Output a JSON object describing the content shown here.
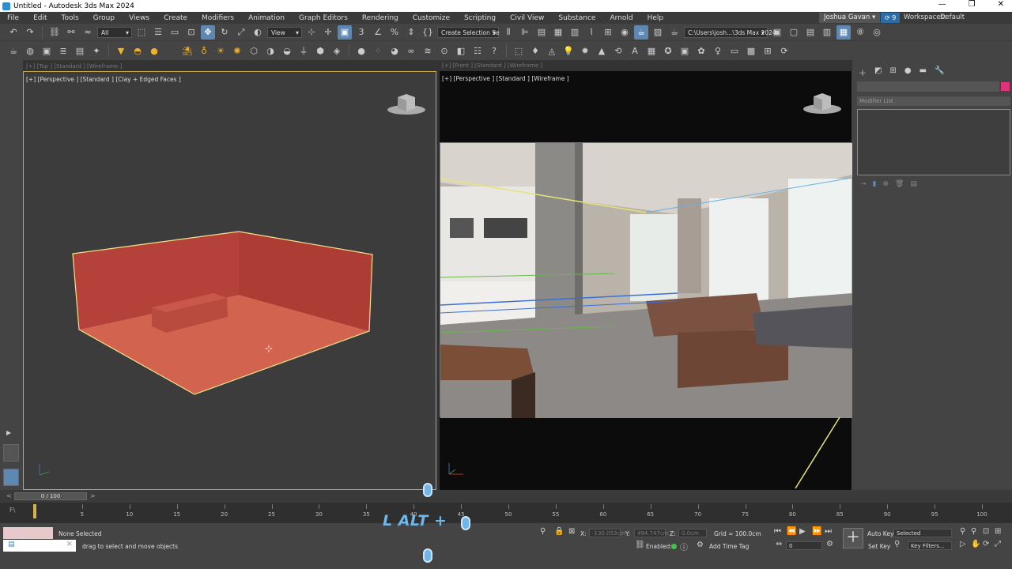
{
  "titlebar": {
    "title": "Untitled - Autodesk 3ds Max 2024",
    "min": "—",
    "restore": "❐",
    "close": "✕"
  },
  "menu": {
    "items": [
      "File",
      "Edit",
      "Tools",
      "Group",
      "Views",
      "Create",
      "Modifiers",
      "Animation",
      "Graph Editors",
      "Rendering",
      "Customize",
      "Scripting",
      "Civil View",
      "Substance",
      "Arnold",
      "Help"
    ],
    "user": "Joshua Gavan ▾",
    "sync_badge": "9",
    "workspaces_label": "Workspaces:",
    "workspaces_value": "Default"
  },
  "toolbar1": {
    "selection_filter": "All",
    "reference_coord": "View",
    "named_selection": "Create Selection Se",
    "project_path": "C:\\Users\\josh...\\3ds Max 2024"
  },
  "viewports": {
    "left": {
      "label": "[+] [Perspective ] [Standard ] [Clay + Edged Faces ]",
      "ghost": "[+] [Top ] [Standard ] [Wireframe ]"
    },
    "right": {
      "label": "[+] [Perspective ] [Standard ] [Wireframe ]",
      "ghost": "[+] [Front ] [Standard ] [Wireframe ]"
    }
  },
  "command_panel": {
    "modifier_list": "Modifier List",
    "accent_color": "#e0347a"
  },
  "timeslider": {
    "position": "0 / 100",
    "left_arrow": "<",
    "right_arrow": ">"
  },
  "trackbar": {
    "label": "F\\",
    "ticks": [
      "5",
      "10",
      "15",
      "20",
      "25",
      "30",
      "35",
      "40",
      "45",
      "50",
      "55",
      "60",
      "65",
      "70",
      "75",
      "80",
      "85",
      "90",
      "95",
      "100"
    ]
  },
  "status": {
    "selection": "None Selected",
    "prompt": "drag to select and move objects",
    "x_label": "X:",
    "x_value": "-130.053cm",
    "y_label": "Y:",
    "y_value": "494.747cm",
    "z_label": "Z:",
    "z_value": "0.0cm",
    "grid": "Grid = 100.0cm",
    "enabled_label": "Enabled:",
    "add_time_tag": "Add Time Tag",
    "auto_key": "Auto Key",
    "set_key": "Set Key",
    "selected_dd": "Selected",
    "key_filters": "Key Filters...",
    "frame_value": "0"
  },
  "overlay": {
    "hotkey_text": "L ALT +"
  },
  "colors": {
    "room_fill": "#b8453a",
    "room_floor": "#d2644f",
    "selection_outline": "#f4e48a",
    "accent_blue": "#5e87b2"
  }
}
